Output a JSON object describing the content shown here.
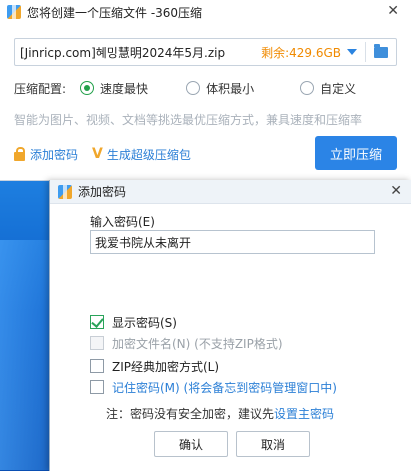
{
  "main_window": {
    "title": "您将创建一个压缩文件 -360压缩",
    "close_glyph": "✕",
    "path_value": "[Jinricp.com]혜밍慧明2024年5月.zip",
    "free_space": "剩余:429.6GB",
    "config_label": "压缩配置:",
    "options": [
      {
        "label": "速度最快",
        "selected": true
      },
      {
        "label": "体积最小",
        "selected": false
      },
      {
        "label": "自定义",
        "selected": false
      }
    ],
    "hint": "智能为图片、视频、文档等挑选最优压缩方式，兼具速度和压缩率",
    "add_password_link": "添加密码",
    "super_archive_link": "生成超级压缩包",
    "compress_button": "立即压缩"
  },
  "password_dialog": {
    "title": "添加密码",
    "close_glyph": "✕",
    "input_label": "输入密码(E)",
    "input_value": "我爱书院从未离开",
    "checkboxes": [
      {
        "label": "显示密码(S)",
        "checked": true,
        "disabled": false
      },
      {
        "label": "加密文件名(N) (不支持ZIP格式)",
        "checked": false,
        "disabled": true
      },
      {
        "label": "ZIP经典加密方式(L)",
        "checked": false,
        "disabled": false
      },
      {
        "label": "记住密码(M) (将会备忘到密码管理窗口中)",
        "checked": false,
        "disabled": false
      }
    ],
    "note_prefix": "注：密码没有安全加密，建议先",
    "note_link": "设置主密码",
    "ok_button": "确认",
    "cancel_button": "取消"
  },
  "colors": {
    "accent": "#2b84e6",
    "free_space": "#f08a00",
    "check_green": "#2aa35a",
    "link_blue": "#2b7fd6"
  }
}
